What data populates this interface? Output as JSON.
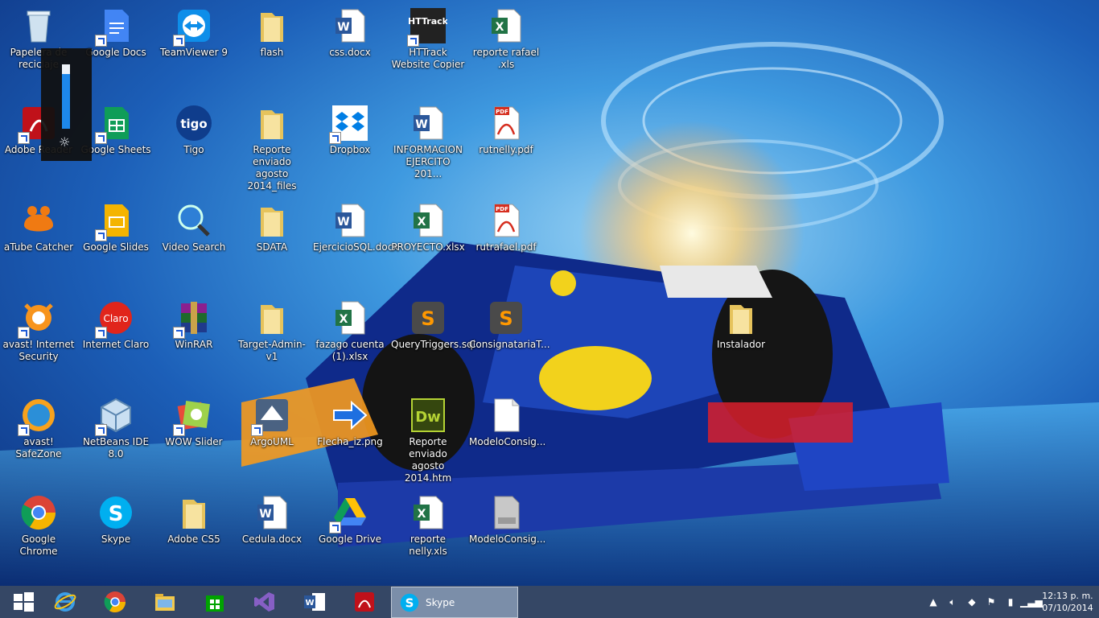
{
  "desktop_icons": {
    "recycle_bin": "Papelera de reciclaje",
    "adobe_reader": "Adobe Reader",
    "atube": "aTube Catcher",
    "avast": "avast! Internet Security",
    "avast_safezone": "avast! SafeZone",
    "chrome": "Google Chrome",
    "gdocs": "Google Docs",
    "gsheets": "Google Sheets",
    "gslides": "Google Slides",
    "claro": "Internet Claro",
    "netbeans": "NetBeans IDE 8.0",
    "skype": "Skype",
    "teamviewer": "TeamViewer 9",
    "tigo": "Tigo",
    "videosearch": "Video Search",
    "winrar": "WinRAR",
    "wowslider": "WOW Slider",
    "adobecs5": "Adobe CS5",
    "flash": "flash",
    "reporte_files": "Reporte enviado agosto 2014_files",
    "sdata": "SDATA",
    "targetadmin": "Target-Admin-v1",
    "argouml": "ArgoUML",
    "cedula": "Cedula.docx",
    "css": "css.docx",
    "dropbox": "Dropbox",
    "ejercicio": "EjercicioSQL.docx",
    "fazago": "fazago cuenta (1).xlsx",
    "flecha": "Flecha_iz.png",
    "gdrive": "Google Drive",
    "httrack": "HTTrack Website Copier",
    "informacion": "INFORMACION EJERCITO 201...",
    "proyecto": "PROYECTO.xlsx",
    "querytriggers": "QueryTriggers.sql",
    "reporte_htm": "Reporte enviado agosto 2014.htm",
    "reporte_nelly": "reporte nelly.xls",
    "reporte_rafael": "reporte rafael .xls",
    "rutnelly": "rutnelly.pdf",
    "rutrafael": "rutrafael.pdf",
    "consignataria": "ConsignatariaT...",
    "modelo1": "ModeloConsig...",
    "modelo2": "ModeloConsig...",
    "instalador": "Instalador",
    "httrack_logo": "HTTrack",
    "tigo_logo": "tigo",
    "claro_logo": "Claro",
    "pdf_tag": "PDF",
    "dw_logo": "Dw"
  },
  "brightness": {
    "level": 0.85
  },
  "taskbar": {
    "skype_label": "Skype",
    "time": "12:13 p. m.",
    "date": "07/10/2014"
  }
}
